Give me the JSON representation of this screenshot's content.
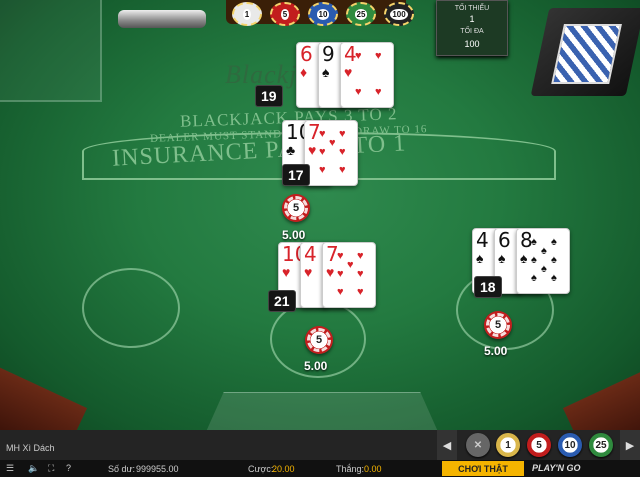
{
  "table": {
    "logo_text": "Blackjack",
    "line1": "BLACKJACK PAYS 3 TO 2",
    "line2": "DEALER MUST STAND ON 17 AND DRAW TO 16",
    "insurance": "INSURANCE PAYS 2 TO 1",
    "limits": {
      "min_label": "TỐI THIỂU",
      "min_value": "1",
      "max_label": "TỐI ĐA",
      "max_value": "100"
    }
  },
  "top_chips": [
    "1",
    "5",
    "10",
    "25",
    "100"
  ],
  "dealer": {
    "score": "19",
    "cards": [
      {
        "rank": "6",
        "suit": "♦",
        "color": "red"
      },
      {
        "rank": "9",
        "suit": "♠",
        "color": "blk"
      },
      {
        "rank": "4",
        "suit": "♥",
        "color": "red"
      }
    ]
  },
  "hands": [
    {
      "score": "17",
      "bet_chip": "5",
      "bet_amount": "5.00",
      "cards": [
        {
          "rank": "10",
          "suit": "♣",
          "color": "blk"
        },
        {
          "rank": "7",
          "suit": "♥",
          "color": "red"
        }
      ]
    },
    {
      "score": "21",
      "bet_chip": "5",
      "bet_amount": "5.00",
      "cards": [
        {
          "rank": "10",
          "suit": "♥",
          "color": "red"
        },
        {
          "rank": "4",
          "suit": "♥",
          "color": "red"
        },
        {
          "rank": "7",
          "suit": "♥",
          "color": "red"
        }
      ]
    },
    {
      "score": "18",
      "bet_chip": "5",
      "bet_amount": "5.00",
      "cards": [
        {
          "rank": "4",
          "suit": "♠",
          "color": "blk"
        },
        {
          "rank": "6",
          "suit": "♠",
          "color": "blk"
        },
        {
          "rank": "8",
          "suit": "♠",
          "color": "blk"
        }
      ]
    }
  ],
  "bottom": {
    "game_name": "MH Xì Dách",
    "balance_label": "Số dư:",
    "balance_value": "999955.00",
    "bet_label": "Cược:",
    "bet_value": "20.00",
    "win_label": "Thắng:",
    "win_value": "0.00",
    "play_button": "CHƠI THẬT",
    "brand": "PLAY'N GO",
    "chips": [
      "1",
      "5",
      "10",
      "25"
    ],
    "help": "?"
  },
  "colors": {
    "felt": "#237a40",
    "gold": "#f5b400",
    "chip_red": "#c21d1d"
  }
}
